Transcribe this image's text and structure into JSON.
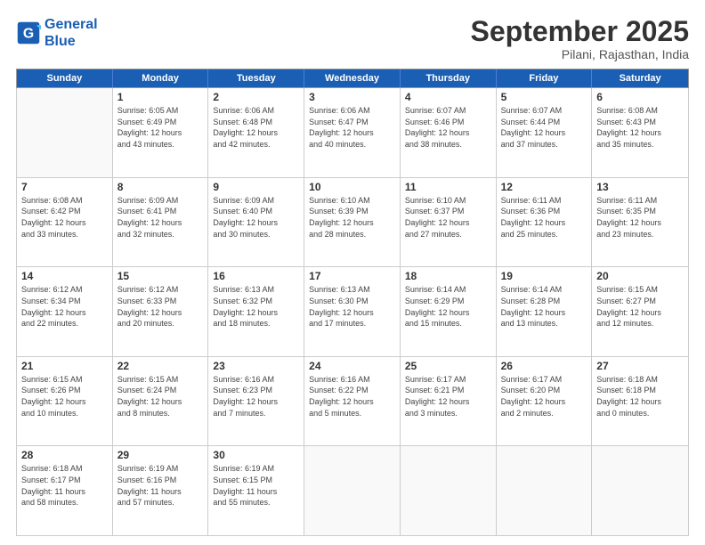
{
  "logo": {
    "line1": "General",
    "line2": "Blue"
  },
  "title": "September 2025",
  "subtitle": "Pilani, Rajasthan, India",
  "days": [
    "Sunday",
    "Monday",
    "Tuesday",
    "Wednesday",
    "Thursday",
    "Friday",
    "Saturday"
  ],
  "weeks": [
    [
      {
        "day": "",
        "info": ""
      },
      {
        "day": "1",
        "info": "Sunrise: 6:05 AM\nSunset: 6:49 PM\nDaylight: 12 hours\nand 43 minutes."
      },
      {
        "day": "2",
        "info": "Sunrise: 6:06 AM\nSunset: 6:48 PM\nDaylight: 12 hours\nand 42 minutes."
      },
      {
        "day": "3",
        "info": "Sunrise: 6:06 AM\nSunset: 6:47 PM\nDaylight: 12 hours\nand 40 minutes."
      },
      {
        "day": "4",
        "info": "Sunrise: 6:07 AM\nSunset: 6:46 PM\nDaylight: 12 hours\nand 38 minutes."
      },
      {
        "day": "5",
        "info": "Sunrise: 6:07 AM\nSunset: 6:44 PM\nDaylight: 12 hours\nand 37 minutes."
      },
      {
        "day": "6",
        "info": "Sunrise: 6:08 AM\nSunset: 6:43 PM\nDaylight: 12 hours\nand 35 minutes."
      }
    ],
    [
      {
        "day": "7",
        "info": "Sunrise: 6:08 AM\nSunset: 6:42 PM\nDaylight: 12 hours\nand 33 minutes."
      },
      {
        "day": "8",
        "info": "Sunrise: 6:09 AM\nSunset: 6:41 PM\nDaylight: 12 hours\nand 32 minutes."
      },
      {
        "day": "9",
        "info": "Sunrise: 6:09 AM\nSunset: 6:40 PM\nDaylight: 12 hours\nand 30 minutes."
      },
      {
        "day": "10",
        "info": "Sunrise: 6:10 AM\nSunset: 6:39 PM\nDaylight: 12 hours\nand 28 minutes."
      },
      {
        "day": "11",
        "info": "Sunrise: 6:10 AM\nSunset: 6:37 PM\nDaylight: 12 hours\nand 27 minutes."
      },
      {
        "day": "12",
        "info": "Sunrise: 6:11 AM\nSunset: 6:36 PM\nDaylight: 12 hours\nand 25 minutes."
      },
      {
        "day": "13",
        "info": "Sunrise: 6:11 AM\nSunset: 6:35 PM\nDaylight: 12 hours\nand 23 minutes."
      }
    ],
    [
      {
        "day": "14",
        "info": "Sunrise: 6:12 AM\nSunset: 6:34 PM\nDaylight: 12 hours\nand 22 minutes."
      },
      {
        "day": "15",
        "info": "Sunrise: 6:12 AM\nSunset: 6:33 PM\nDaylight: 12 hours\nand 20 minutes."
      },
      {
        "day": "16",
        "info": "Sunrise: 6:13 AM\nSunset: 6:32 PM\nDaylight: 12 hours\nand 18 minutes."
      },
      {
        "day": "17",
        "info": "Sunrise: 6:13 AM\nSunset: 6:30 PM\nDaylight: 12 hours\nand 17 minutes."
      },
      {
        "day": "18",
        "info": "Sunrise: 6:14 AM\nSunset: 6:29 PM\nDaylight: 12 hours\nand 15 minutes."
      },
      {
        "day": "19",
        "info": "Sunrise: 6:14 AM\nSunset: 6:28 PM\nDaylight: 12 hours\nand 13 minutes."
      },
      {
        "day": "20",
        "info": "Sunrise: 6:15 AM\nSunset: 6:27 PM\nDaylight: 12 hours\nand 12 minutes."
      }
    ],
    [
      {
        "day": "21",
        "info": "Sunrise: 6:15 AM\nSunset: 6:26 PM\nDaylight: 12 hours\nand 10 minutes."
      },
      {
        "day": "22",
        "info": "Sunrise: 6:15 AM\nSunset: 6:24 PM\nDaylight: 12 hours\nand 8 minutes."
      },
      {
        "day": "23",
        "info": "Sunrise: 6:16 AM\nSunset: 6:23 PM\nDaylight: 12 hours\nand 7 minutes."
      },
      {
        "day": "24",
        "info": "Sunrise: 6:16 AM\nSunset: 6:22 PM\nDaylight: 12 hours\nand 5 minutes."
      },
      {
        "day": "25",
        "info": "Sunrise: 6:17 AM\nSunset: 6:21 PM\nDaylight: 12 hours\nand 3 minutes."
      },
      {
        "day": "26",
        "info": "Sunrise: 6:17 AM\nSunset: 6:20 PM\nDaylight: 12 hours\nand 2 minutes."
      },
      {
        "day": "27",
        "info": "Sunrise: 6:18 AM\nSunset: 6:18 PM\nDaylight: 12 hours\nand 0 minutes."
      }
    ],
    [
      {
        "day": "28",
        "info": "Sunrise: 6:18 AM\nSunset: 6:17 PM\nDaylight: 11 hours\nand 58 minutes."
      },
      {
        "day": "29",
        "info": "Sunrise: 6:19 AM\nSunset: 6:16 PM\nDaylight: 11 hours\nand 57 minutes."
      },
      {
        "day": "30",
        "info": "Sunrise: 6:19 AM\nSunset: 6:15 PM\nDaylight: 11 hours\nand 55 minutes."
      },
      {
        "day": "",
        "info": ""
      },
      {
        "day": "",
        "info": ""
      },
      {
        "day": "",
        "info": ""
      },
      {
        "day": "",
        "info": ""
      }
    ]
  ]
}
